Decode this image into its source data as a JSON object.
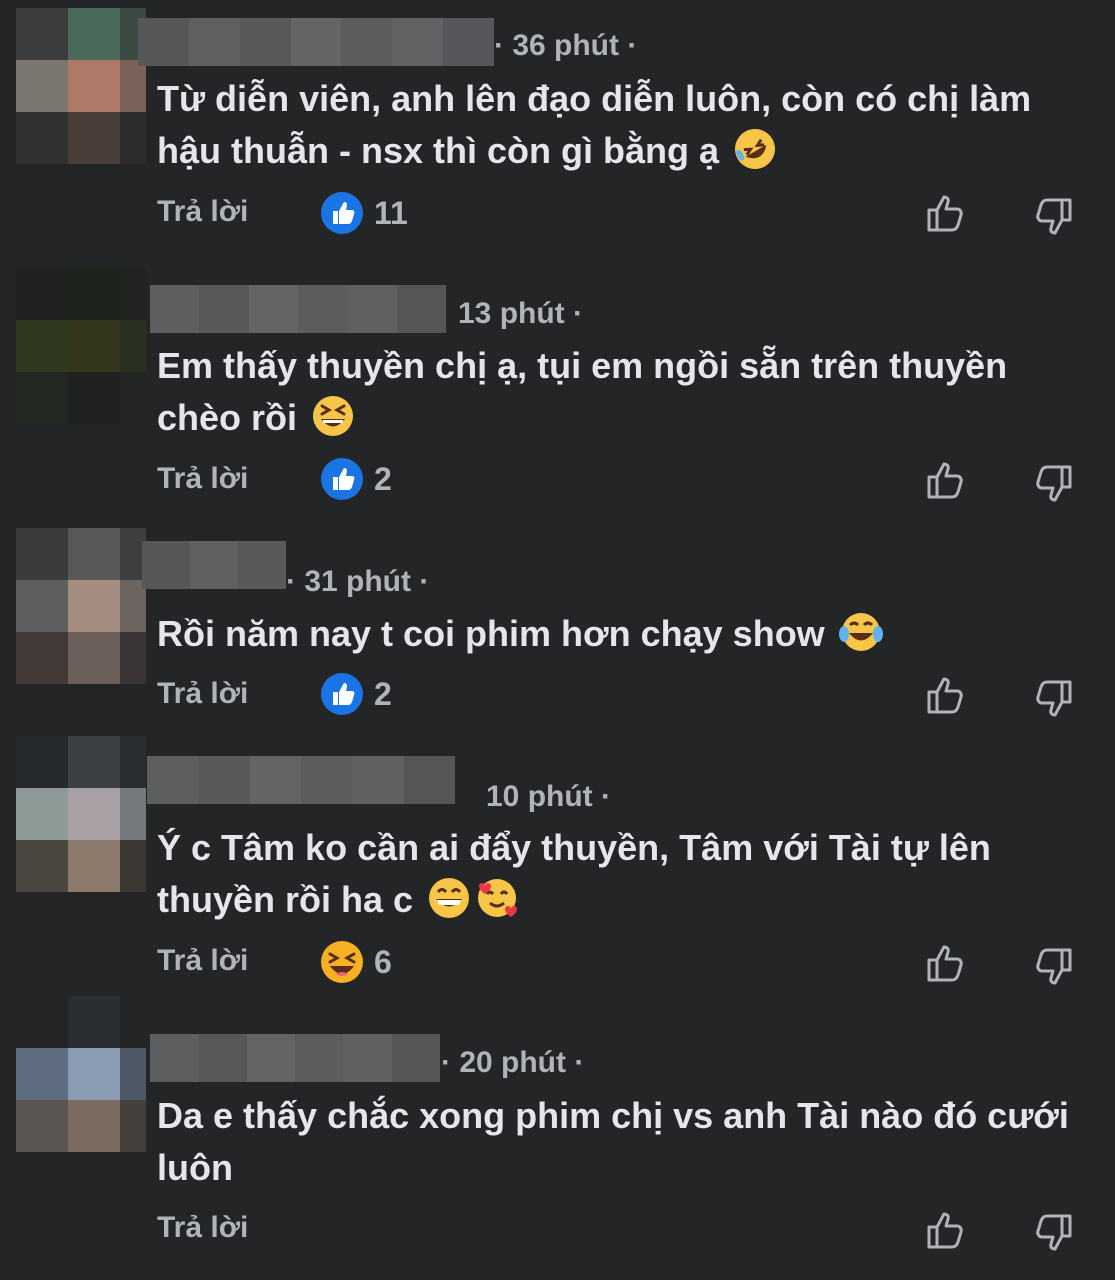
{
  "colors": {
    "background": "#242526",
    "text": "#e4e6eb",
    "muted": "#b0b3b8",
    "like_blue": "#1b74e4"
  },
  "comments": [
    {
      "time": "· 36 phút ·",
      "text": "Từ diễn viên, anh lên đạo diễn luôn, còn có chị làm hậu thuẫn - nsx thì còn gì bằng ạ",
      "emojis": [
        "rolling-on-floor-laughing-emoji"
      ],
      "reply_label": "Trả lời",
      "reaction_icon": "like-icon",
      "reaction_count": "11"
    },
    {
      "time": "13 phút ·",
      "text": "Em thấy thuyền chị ạ, tụi em ngồi sẵn trên thuyền chèo rồi",
      "emojis": [
        "grinning-squinting-face-emoji"
      ],
      "reply_label": "Trả lời",
      "reaction_icon": "like-icon",
      "reaction_count": "2"
    },
    {
      "time": "· 31 phút ·",
      "text": "Rồi năm nay t coi phim hơn chạy show",
      "emojis": [
        "tears-of-joy-emoji"
      ],
      "reply_label": "Trả lời",
      "reaction_icon": "like-icon",
      "reaction_count": "2"
    },
    {
      "time": "10 phút ·",
      "text": "Ý c Tâm ko cần ai đẩy thuyền, Tâm với Tài tự lên thuyền rồi ha c",
      "emojis": [
        "beaming-face-emoji",
        "smiling-face-with-hearts-emoji"
      ],
      "reply_label": "Trả lời",
      "reaction_icon": "haha-icon",
      "reaction_count": "6"
    },
    {
      "time": "· 20 phút ·",
      "text": "Da e thấy chắc xong phim chị vs anh Tài nào đó cưới luôn",
      "emojis": [],
      "reply_label": "Trả lời",
      "reaction_icon": "",
      "reaction_count": ""
    }
  ]
}
